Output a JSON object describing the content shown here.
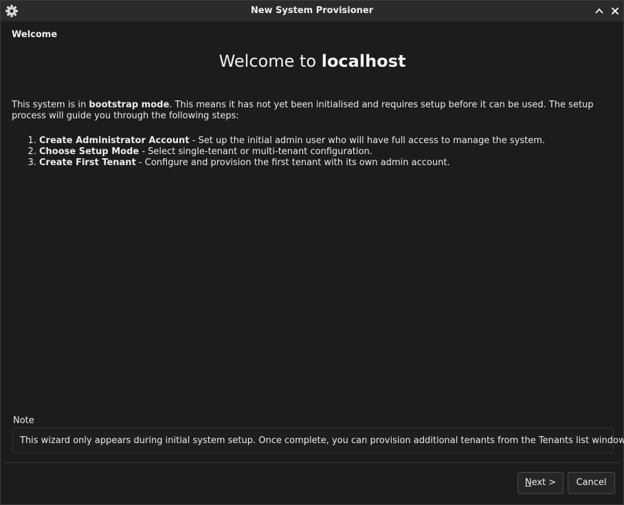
{
  "window": {
    "title": "New System Provisioner",
    "app_icon": "gear-icon",
    "controls": {
      "up_icon": "chevron-up-icon",
      "close_icon": "close-icon"
    }
  },
  "page": {
    "header": "Welcome",
    "heading_prefix": "Welcome to ",
    "heading_host": "localhost",
    "intro": {
      "before_bold": "This system is in ",
      "bold": "bootstrap mode",
      "after_bold": ". This means it has not yet been initialised and requires setup before it can be used. The setup process will guide you through the following steps:"
    },
    "steps": [
      {
        "title": "Create Administrator Account",
        "desc": " - Set up the initial admin user who will have full access to manage the system."
      },
      {
        "title": "Choose Setup Mode",
        "desc": " - Select single-tenant or multi-tenant configuration."
      },
      {
        "title": "Create First Tenant",
        "desc": " - Configure and provision the first tenant with its own admin account."
      }
    ],
    "note": {
      "label": "Note",
      "text": "This wizard only appears during initial system setup. Once complete, you can provision additional tenants from the Tenants list window."
    }
  },
  "buttons": {
    "next_mnemonic": "N",
    "next_rest": "ext >",
    "cancel": "Cancel"
  },
  "colors": {
    "background": "#1c1c1c",
    "titlebar": "#2b2b2b",
    "text": "#ececec"
  }
}
